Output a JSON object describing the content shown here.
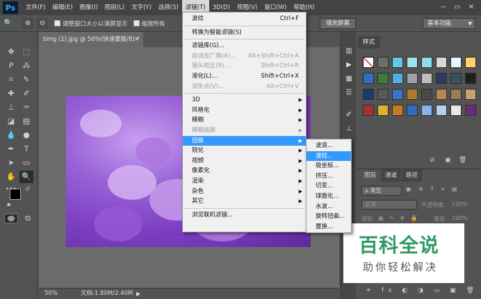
{
  "app": {
    "logo": "Ps"
  },
  "menubar": {
    "items": [
      "文件(F)",
      "编辑(E)",
      "图像(I)",
      "图层(L)",
      "文字(Y)",
      "选择(S)",
      "滤镜(T)",
      "3D(D)",
      "视图(V)",
      "窗口(W)",
      "帮助(H)"
    ],
    "active_index": 6
  },
  "window_controls": {
    "minimize": "−",
    "restore": "▭",
    "close": "✕"
  },
  "options_bar": {
    "tool_icon": "zoom-icon",
    "resize_windows_label": "调整窗口大小以满屏显示",
    "zoom_all_label": "缩放所有",
    "fill_screen_button": "填充屏幕",
    "workspace": "基本功能"
  },
  "document": {
    "tab_title": "timg (1).jpg @ 50%(快速蒙版/8) *",
    "zoom": "50%",
    "doc_info": "文档:1.80M/2.40M"
  },
  "filter_menu": {
    "items": [
      {
        "label": "波纹",
        "shortcut": "Ctrl+F",
        "disabled": false,
        "submenu": false
      },
      {
        "label": "转换为智能滤镜(S)",
        "shortcut": "",
        "disabled": false,
        "submenu": false
      },
      {
        "label": "滤镜库(G)...",
        "shortcut": "",
        "disabled": false,
        "submenu": false
      },
      {
        "label": "自适应广角(A)...",
        "shortcut": "Alt+Shift+Ctrl+A",
        "disabled": true,
        "submenu": false
      },
      {
        "label": "镜头校正(R)...",
        "shortcut": "Shift+Ctrl+R",
        "disabled": true,
        "submenu": false
      },
      {
        "label": "液化(L)...",
        "shortcut": "Shift+Ctrl+X",
        "disabled": false,
        "submenu": false
      },
      {
        "label": "消失点(V)...",
        "shortcut": "Alt+Ctrl+V",
        "disabled": true,
        "submenu": false
      },
      {
        "label": "3D",
        "shortcut": "",
        "disabled": false,
        "submenu": true
      },
      {
        "label": "风格化",
        "shortcut": "",
        "disabled": false,
        "submenu": true
      },
      {
        "label": "模糊",
        "shortcut": "",
        "disabled": false,
        "submenu": true
      },
      {
        "label": "模糊画廊",
        "shortcut": "",
        "disabled": true,
        "submenu": true
      },
      {
        "label": "扭曲",
        "shortcut": "",
        "disabled": false,
        "submenu": true,
        "highlighted": true
      },
      {
        "label": "锐化",
        "shortcut": "",
        "disabled": false,
        "submenu": true
      },
      {
        "label": "视频",
        "shortcut": "",
        "disabled": false,
        "submenu": true
      },
      {
        "label": "像素化",
        "shortcut": "",
        "disabled": false,
        "submenu": true
      },
      {
        "label": "渲染",
        "shortcut": "",
        "disabled": false,
        "submenu": true
      },
      {
        "label": "杂色",
        "shortcut": "",
        "disabled": false,
        "submenu": true
      },
      {
        "label": "其它",
        "shortcut": "",
        "disabled": false,
        "submenu": true
      },
      {
        "label": "浏览联机滤镜...",
        "shortcut": "",
        "disabled": false,
        "submenu": false
      }
    ]
  },
  "distort_submenu": {
    "items": [
      "波浪...",
      "波纹...",
      "极坐标...",
      "挤压...",
      "切变...",
      "球面化...",
      "水波...",
      "旋转扭曲...",
      "置换..."
    ],
    "highlighted_index": 1
  },
  "styles_panel": {
    "tab": "样式"
  },
  "layers_panel": {
    "tabs": [
      "图层",
      "通道",
      "路径"
    ],
    "filter_kind": "ρ 类型",
    "blend_mode": "正常",
    "opacity_label": "不透明度:",
    "opacity_value": "100%",
    "lock_label": "锁定:",
    "fill_label": "填充:",
    "fill_value": "100%"
  },
  "watermark": {
    "title": "百科全说",
    "subtitle": "助你轻松解决"
  },
  "colors": {
    "menu_highlight": "#3399ff",
    "watermark_green": "#2f9a62"
  }
}
